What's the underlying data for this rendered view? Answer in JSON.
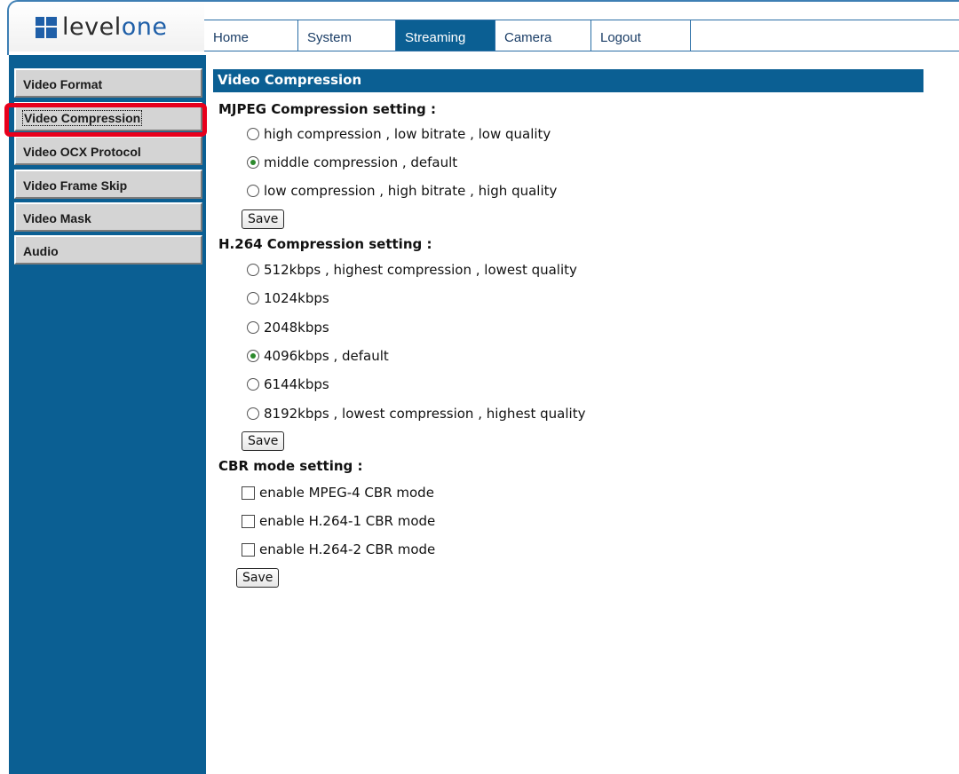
{
  "brand": {
    "logo_text_a": "level",
    "logo_text_b": "one"
  },
  "nav": {
    "tabs": [
      "Home",
      "System",
      "Streaming",
      "Camera",
      "Logout"
    ],
    "active": "Streaming"
  },
  "sidebar": {
    "items": [
      "Video Format",
      "Video Compression",
      "Video OCX Protocol",
      "Video Frame Skip",
      "Video Mask",
      "Audio"
    ],
    "selected": "Video Compression"
  },
  "page": {
    "title": "Video Compression"
  },
  "mjpeg": {
    "label": "MJPEG Compression setting :",
    "options": [
      {
        "label": "high compression , low bitrate , low quality",
        "checked": false
      },
      {
        "label": "middle compression , default",
        "checked": true
      },
      {
        "label": "low compression , high bitrate , high quality",
        "checked": false
      }
    ],
    "save_label": "Save"
  },
  "h264": {
    "label": "H.264 Compression setting :",
    "options": [
      {
        "label": "512kbps , highest compression , lowest quality",
        "checked": false
      },
      {
        "label": "1024kbps",
        "checked": false
      },
      {
        "label": "2048kbps",
        "checked": false
      },
      {
        "label": "4096kbps , default",
        "checked": true
      },
      {
        "label": "6144kbps",
        "checked": false
      },
      {
        "label": "8192kbps , lowest compression , highest quality",
        "checked": false
      }
    ],
    "save_label": "Save"
  },
  "cbr": {
    "label": "CBR mode setting :",
    "options": [
      {
        "label": "enable MPEG-4 CBR mode",
        "checked": false
      },
      {
        "label": "enable H.264-1 CBR mode",
        "checked": false
      },
      {
        "label": "enable H.264-2 CBR mode",
        "checked": false
      }
    ],
    "save_label": "Save"
  },
  "colors": {
    "accent": "#0b5f93",
    "highlight": "#e8001c",
    "panel": "#d4d4d4"
  }
}
